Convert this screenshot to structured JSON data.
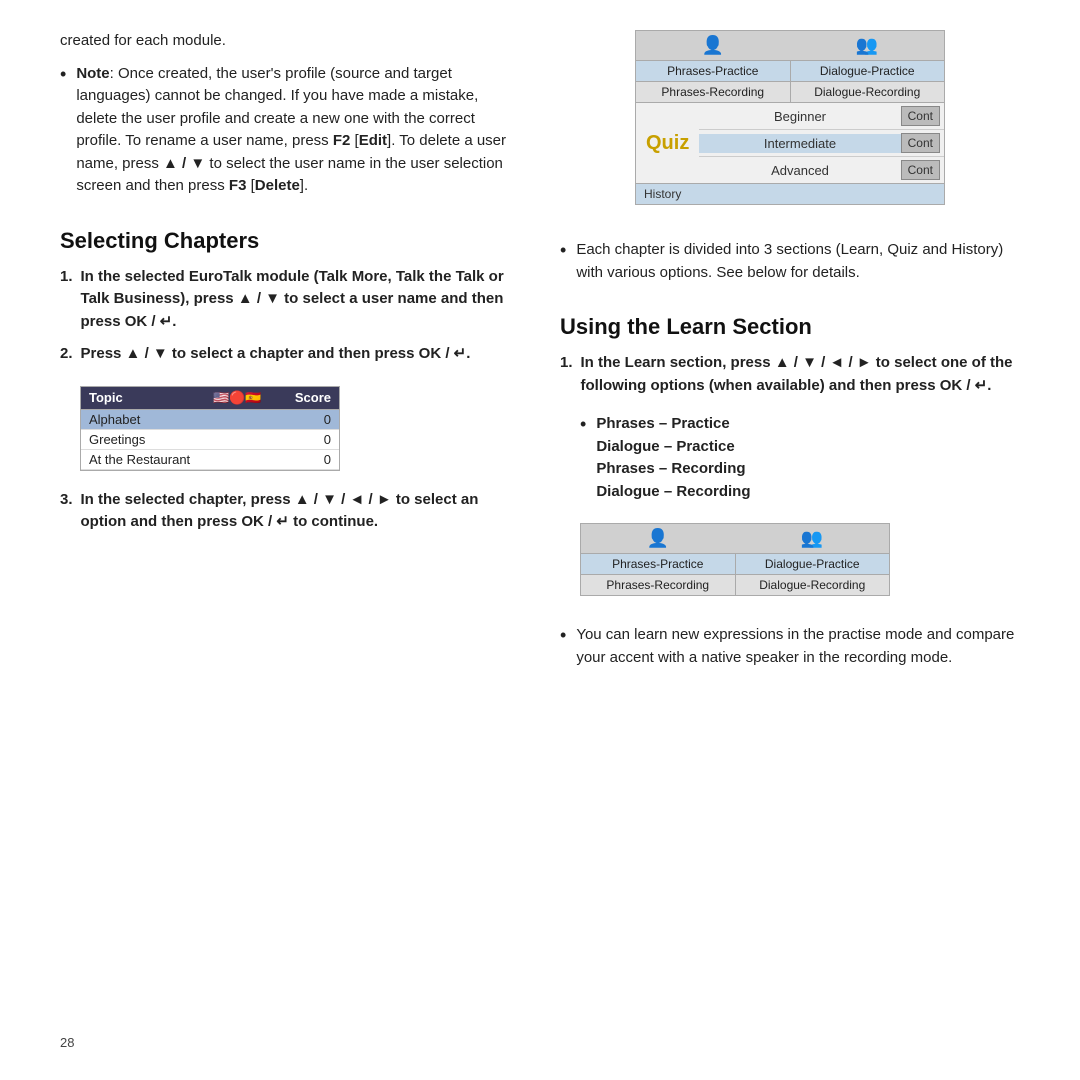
{
  "page": {
    "number": "28"
  },
  "left": {
    "intro": "created for each module.",
    "note_bullet": "Note: Once created, the user's profile (source and target languages) cannot be changed. If you have made a mistake, delete the user profile and create a new one with the correct profile. To rename a user name, press F2 [Edit]. To delete a user name, press ▲ / ▼ to select the user name in the user selection screen and then press F3 [Delete].",
    "selecting_chapters_heading": "Selecting Chapters",
    "step1": "In the selected EuroTalk module (Talk More, Talk the Talk or Talk Business), press ▲ / ▼ to select a user name and then press OK / ↵.",
    "step2": "Press ▲ / ▼ to select a chapter and then press OK / ↵.",
    "step3": "In the selected chapter, press ▲ / ▼ / ◄ / ► to select an option and then press OK / ↵ to continue.",
    "table": {
      "col_topic": "Topic",
      "col_score": "Score",
      "rows": [
        {
          "topic": "Alphabet",
          "score": "0",
          "selected": true
        },
        {
          "topic": "Greetings",
          "score": "0",
          "selected": false
        },
        {
          "topic": "At the Restaurant",
          "score": "0",
          "selected": false
        }
      ]
    }
  },
  "right": {
    "quiz_widget": {
      "tab1": "Phrases-Practice",
      "tab2": "Dialogue-Practice",
      "tab3": "Phrases-Recording",
      "tab4": "Dialogue-Recording",
      "quiz_label": "Quiz",
      "beginner": "Beginner",
      "intermediate": "Intermediate",
      "advanced": "Advanced",
      "cont_label": "Cont",
      "history_label": "History"
    },
    "bullet1": "Each chapter is divided into 3 sections (Learn, Quiz and History) with various options. See below for details.",
    "using_learn_heading": "Using the Learn Section",
    "learn_step1": "In the Learn section, press ▲ / ▼ / ◄ / ► to select one of the following options (when available) and then press OK / ↵.",
    "learn_bullet_phrases": "Phrases – Practice",
    "learn_bullet_dialogue": "Dialogue – Practice",
    "learn_bullet_phrases_rec": "Phrases – Recording",
    "learn_bullet_dialogue_rec": "Dialogue – Recording",
    "phrases_widget": {
      "tab1": "Phrases-Practice",
      "tab2": "Dialogue-Practice",
      "tab3": "Phrases-Recording",
      "tab4": "Dialogue-Recording"
    },
    "learn_bullet2": "You can learn new expressions in the practise mode and compare your accent with a native speaker in the recording mode."
  }
}
